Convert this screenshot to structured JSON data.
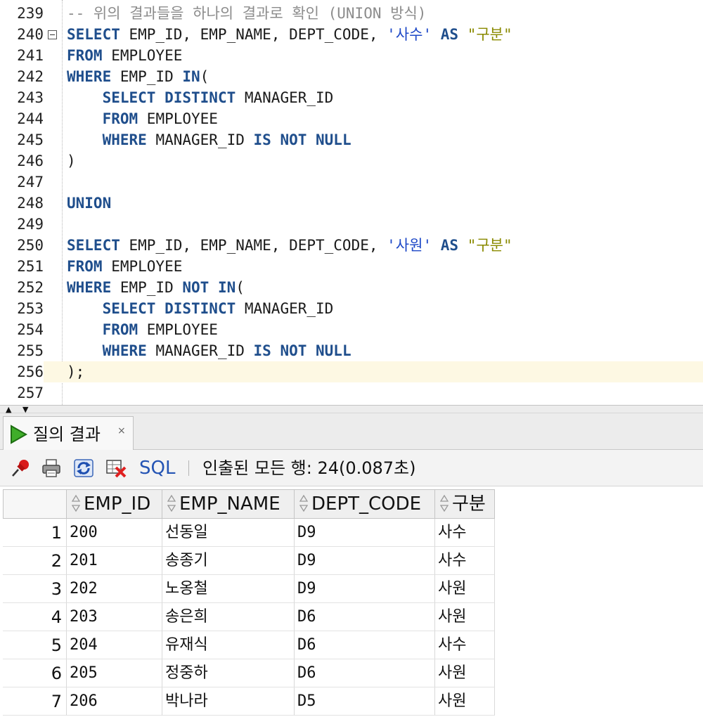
{
  "editor": {
    "lines": [
      {
        "num": "239",
        "tokens": [
          {
            "t": "-- 위의 결과들을 하나의 결과로 확인 (UNION 방식)",
            "c": "cm"
          }
        ]
      },
      {
        "num": "240",
        "fold": true,
        "tokens": [
          {
            "t": "SELECT",
            "c": "kw"
          },
          {
            "t": " EMP_ID, EMP_NAME, DEPT_CODE, ",
            "c": "plain"
          },
          {
            "t": "'사수'",
            "c": "str"
          },
          {
            "t": " ",
            "c": "plain"
          },
          {
            "t": "AS",
            "c": "kw"
          },
          {
            "t": " ",
            "c": "plain"
          },
          {
            "t": "\"구분\"",
            "c": "alias"
          }
        ]
      },
      {
        "num": "241",
        "tokens": [
          {
            "t": "FROM",
            "c": "kw"
          },
          {
            "t": " EMPLOYEE",
            "c": "plain"
          }
        ]
      },
      {
        "num": "242",
        "tokens": [
          {
            "t": "WHERE",
            "c": "kw"
          },
          {
            "t": " EMP_ID ",
            "c": "plain"
          },
          {
            "t": "IN",
            "c": "kw"
          },
          {
            "t": "(",
            "c": "plain"
          }
        ]
      },
      {
        "num": "243",
        "tokens": [
          {
            "t": "    ",
            "c": "plain"
          },
          {
            "t": "SELECT DISTINCT",
            "c": "kw"
          },
          {
            "t": " MANAGER_ID",
            "c": "plain"
          }
        ]
      },
      {
        "num": "244",
        "tokens": [
          {
            "t": "    ",
            "c": "plain"
          },
          {
            "t": "FROM",
            "c": "kw"
          },
          {
            "t": " EMPLOYEE",
            "c": "plain"
          }
        ]
      },
      {
        "num": "245",
        "tokens": [
          {
            "t": "    ",
            "c": "plain"
          },
          {
            "t": "WHERE",
            "c": "kw"
          },
          {
            "t": " MANAGER_ID ",
            "c": "plain"
          },
          {
            "t": "IS NOT NULL",
            "c": "kw"
          }
        ]
      },
      {
        "num": "246",
        "tokens": [
          {
            "t": ")",
            "c": "plain"
          }
        ]
      },
      {
        "num": "247",
        "tokens": []
      },
      {
        "num": "248",
        "tokens": [
          {
            "t": "UNION",
            "c": "kw"
          }
        ]
      },
      {
        "num": "249",
        "tokens": []
      },
      {
        "num": "250",
        "tokens": [
          {
            "t": "SELECT",
            "c": "kw"
          },
          {
            "t": " EMP_ID, EMP_NAME, DEPT_CODE, ",
            "c": "plain"
          },
          {
            "t": "'사원'",
            "c": "str"
          },
          {
            "t": " ",
            "c": "plain"
          },
          {
            "t": "AS",
            "c": "kw"
          },
          {
            "t": " ",
            "c": "plain"
          },
          {
            "t": "\"구분\"",
            "c": "alias"
          }
        ]
      },
      {
        "num": "251",
        "tokens": [
          {
            "t": "FROM",
            "c": "kw"
          },
          {
            "t": " EMPLOYEE",
            "c": "plain"
          }
        ]
      },
      {
        "num": "252",
        "tokens": [
          {
            "t": "WHERE",
            "c": "kw"
          },
          {
            "t": " EMP_ID ",
            "c": "plain"
          },
          {
            "t": "NOT IN",
            "c": "kw"
          },
          {
            "t": "(",
            "c": "plain"
          }
        ]
      },
      {
        "num": "253",
        "tokens": [
          {
            "t": "    ",
            "c": "plain"
          },
          {
            "t": "SELECT DISTINCT",
            "c": "kw"
          },
          {
            "t": " MANAGER_ID",
            "c": "plain"
          }
        ]
      },
      {
        "num": "254",
        "tokens": [
          {
            "t": "    ",
            "c": "plain"
          },
          {
            "t": "FROM",
            "c": "kw"
          },
          {
            "t": " EMPLOYEE",
            "c": "plain"
          }
        ]
      },
      {
        "num": "255",
        "tokens": [
          {
            "t": "    ",
            "c": "plain"
          },
          {
            "t": "WHERE",
            "c": "kw"
          },
          {
            "t": " MANAGER_ID ",
            "c": "plain"
          },
          {
            "t": "IS NOT NULL",
            "c": "kw"
          }
        ]
      },
      {
        "num": "256",
        "current": true,
        "tokens": [
          {
            "t": ");",
            "c": "plain"
          }
        ]
      },
      {
        "num": "257",
        "tokens": []
      }
    ]
  },
  "results": {
    "tab_label": "질의 결과",
    "tab_close": "×",
    "toolbar": {
      "sql_label": "SQL",
      "status": "인출된 모든 행: 24(0.087초)"
    },
    "columns": [
      "EMP_ID",
      "EMP_NAME",
      "DEPT_CODE",
      "구분"
    ],
    "rows": [
      {
        "n": "1",
        "emp_id": "200",
        "emp_name": "선동일",
        "dept_code": "D9",
        "kind": "사수"
      },
      {
        "n": "2",
        "emp_id": "201",
        "emp_name": "송종기",
        "dept_code": "D9",
        "kind": "사수"
      },
      {
        "n": "3",
        "emp_id": "202",
        "emp_name": "노옹철",
        "dept_code": "D9",
        "kind": "사원"
      },
      {
        "n": "4",
        "emp_id": "203",
        "emp_name": "송은희",
        "dept_code": "D6",
        "kind": "사원"
      },
      {
        "n": "5",
        "emp_id": "204",
        "emp_name": "유재식",
        "dept_code": "D6",
        "kind": "사수"
      },
      {
        "n": "6",
        "emp_id": "205",
        "emp_name": "정중하",
        "dept_code": "D6",
        "kind": "사원"
      },
      {
        "n": "7",
        "emp_id": "206",
        "emp_name": "박나라",
        "dept_code": "D5",
        "kind": "사원"
      }
    ]
  },
  "icons": {
    "run": "run-icon",
    "pin": "pin-icon",
    "print": "print-icon",
    "refresh": "refresh-icon",
    "clear": "clear-grid-icon",
    "sort": "sort-icon"
  },
  "colors": {
    "keyword": "#1f4e8c",
    "string": "#1d48c7",
    "alias": "#8a8a00",
    "comment": "#8c8c8c",
    "current_line": "#fdf8e3",
    "link": "#2454b4"
  }
}
